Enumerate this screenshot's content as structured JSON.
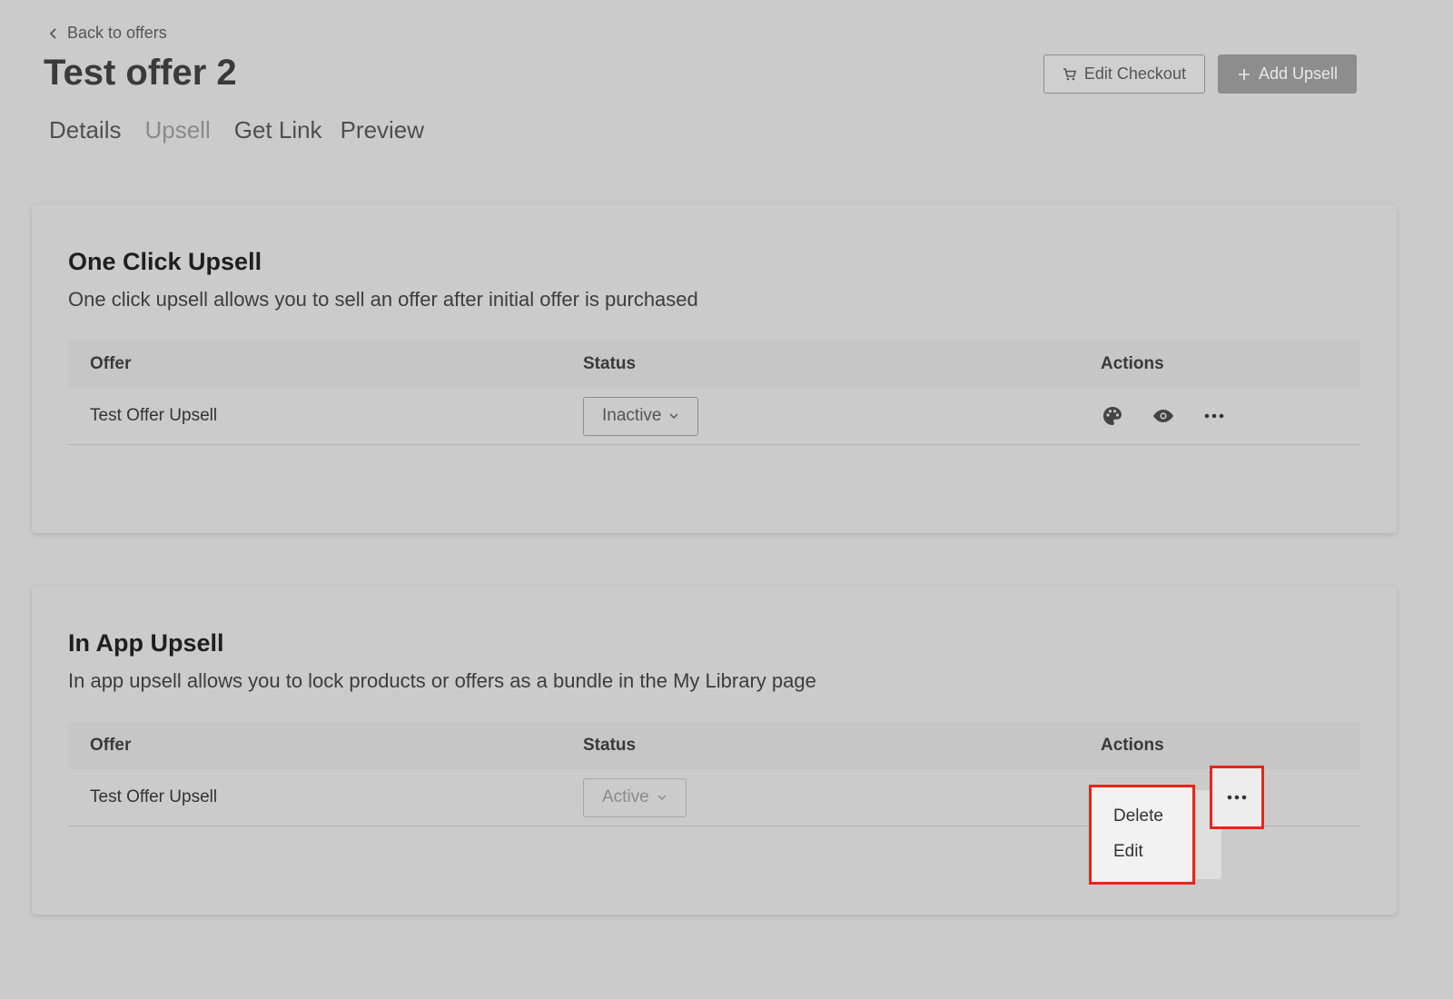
{
  "header": {
    "back_label": "Back to offers",
    "title": "Test offer 2",
    "edit_checkout_label": "Edit Checkout",
    "add_upsell_label": "Add Upsell"
  },
  "tabs": [
    {
      "label": "Details",
      "active": false
    },
    {
      "label": "Upsell",
      "active": true
    },
    {
      "label": "Get Link",
      "active": false
    },
    {
      "label": "Preview",
      "active": false
    }
  ],
  "one_click": {
    "title": "One Click Upsell",
    "description": "One click upsell allows you to sell an offer after initial offer is purchased",
    "columns": {
      "offer": "Offer",
      "status": "Status",
      "actions": "Actions"
    },
    "rows": [
      {
        "offer": "Test Offer Upsell",
        "status": "Inactive"
      }
    ]
  },
  "in_app": {
    "title": "In App Upsell",
    "description": "In app upsell allows you to lock products or offers as a bundle in the My Library page",
    "columns": {
      "offer": "Offer",
      "status": "Status",
      "actions": "Actions"
    },
    "rows": [
      {
        "offer": "Test Offer Upsell",
        "status": "Active"
      }
    ]
  },
  "menu": {
    "items": [
      "Delete",
      "Edit"
    ]
  },
  "icons": {
    "back": "chevron-left-icon",
    "cart": "cart-icon",
    "plus": "plus-icon",
    "palette": "palette-icon",
    "eye": "eye-icon",
    "more": "more-horizontal-icon",
    "dropdown": "chevron-down-icon"
  },
  "colors": {
    "highlight": "#e8251b",
    "background": "#cbcbcb"
  }
}
